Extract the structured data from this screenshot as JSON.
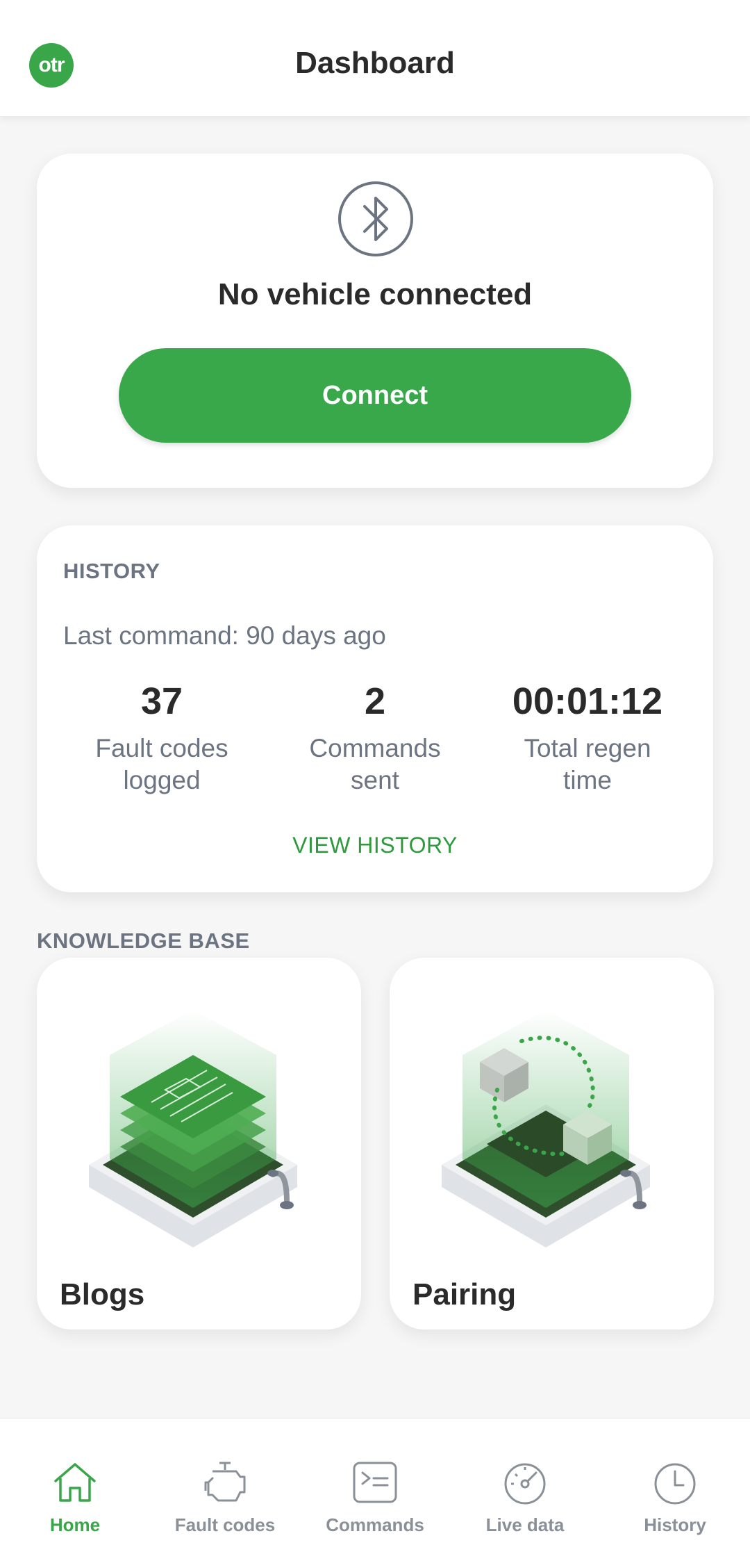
{
  "header": {
    "logo_text": "otr",
    "title": "Dashboard"
  },
  "connection": {
    "status_text": "No vehicle connected",
    "connect_label": "Connect",
    "icon": "bluetooth-icon"
  },
  "history": {
    "section_label": "HISTORY",
    "last_command": "Last command: 90 days ago",
    "stats": [
      {
        "value": "37",
        "label_line1": "Fault codes",
        "label_line2": "logged"
      },
      {
        "value": "2",
        "label_line1": "Commands",
        "label_line2": "sent"
      },
      {
        "value": "00:01:12",
        "label_line1": "Total regen",
        "label_line2": "time"
      }
    ],
    "view_link": "VIEW HISTORY"
  },
  "knowledge_base": {
    "section_label": "KNOWLEDGE BASE",
    "items": [
      {
        "title": "Blogs",
        "icon": "blogs-illustration"
      },
      {
        "title": "Pairing",
        "icon": "pairing-illustration"
      }
    ]
  },
  "nav": {
    "active": "Home",
    "items": [
      {
        "label": "Home",
        "icon": "home-icon"
      },
      {
        "label": "Fault codes",
        "icon": "engine-icon"
      },
      {
        "label": "Commands",
        "icon": "terminal-icon"
      },
      {
        "label": "Live data",
        "icon": "gauge-icon"
      },
      {
        "label": "History",
        "icon": "clock-icon"
      }
    ]
  },
  "colors": {
    "brand_green": "#38a84a",
    "link_green": "#2e9a3d",
    "muted_text": "#6b7480",
    "nav_inactive": "#8a9098"
  }
}
